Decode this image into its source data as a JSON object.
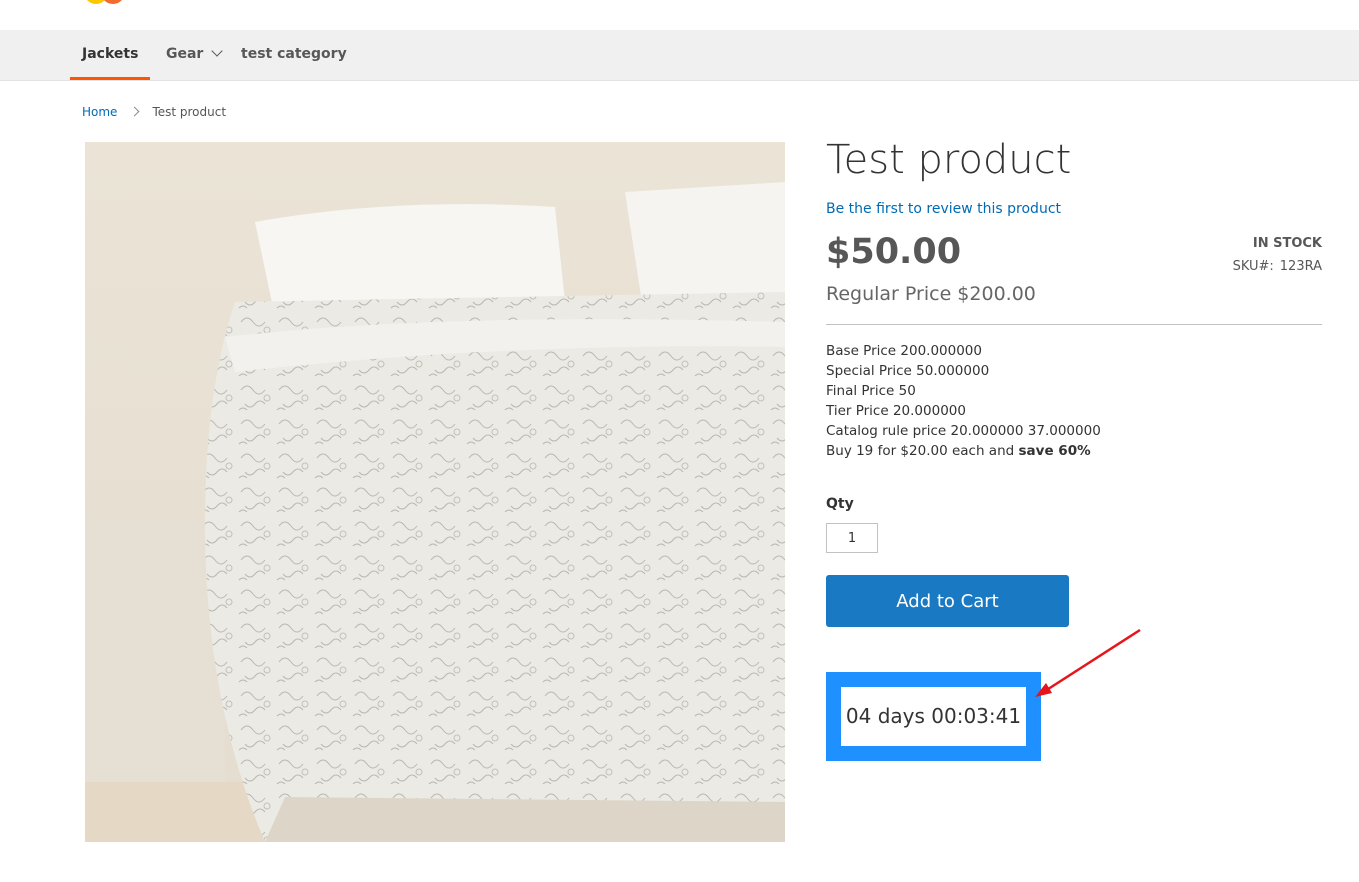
{
  "header": {
    "logo_name": "brand-logo"
  },
  "nav": {
    "items": [
      {
        "label": "Jackets"
      },
      {
        "label": "Gear"
      },
      {
        "label": "test category"
      }
    ]
  },
  "breadcrumb": {
    "home": "Home",
    "current": "Test product"
  },
  "product": {
    "title": "Test product",
    "review_link": "Be the first to review this product",
    "price": "$50.00",
    "regular_price": "Regular Price $200.00",
    "stock": "IN STOCK",
    "sku_label": "SKU#:",
    "sku_value": "123RA",
    "details": {
      "base_price": "Base Price 200.000000",
      "special_price": "Special Price 50.000000",
      "final_price": "Final Price 50",
      "tier_price": "Tier Price 20.000000",
      "catalog_rule": "Catalog rule price 20.000000 37.000000",
      "buy_text": "Buy 19 for $20.00 each and",
      "save_text": "save 60%"
    },
    "qty_label": "Qty",
    "qty_value": "1",
    "add_to_cart": "Add to Cart",
    "countdown": "04 days 00:03:41"
  },
  "colors": {
    "accent": "#1979c3",
    "link": "#006bb4",
    "nav_active": "#ff5501",
    "timer_border": "#1e90ff",
    "annotation_arrow": "#e8141b"
  }
}
